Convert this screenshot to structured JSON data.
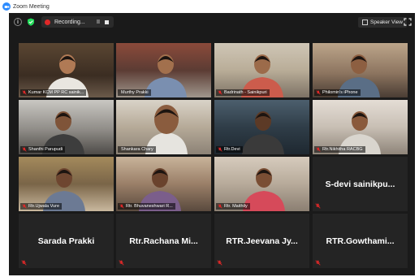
{
  "titlebar": {
    "title": "Zoom Meeting"
  },
  "topbar": {
    "recording_label": "Recording...",
    "pause_glyph": "II",
    "view_label": "Speaker View"
  },
  "colors": {
    "active_speaker_border": "#c9e53f",
    "recording": "#e02828",
    "mic_muted": "#e02828"
  },
  "participants": [
    {
      "name": "Kumar KCM PP RC sainik...",
      "video": true,
      "muted": true
    },
    {
      "name": "Murthy Prakki",
      "video": true,
      "muted": false
    },
    {
      "name": "Badrinath - Sainikpuri",
      "video": true,
      "muted": true
    },
    {
      "name": "Philomin's iPhone",
      "video": true,
      "muted": true
    },
    {
      "name": "Shanthi Parupudi",
      "video": true,
      "muted": true
    },
    {
      "name": "Shankara Chary",
      "video": true,
      "muted": false,
      "active": true
    },
    {
      "name": "Rtr.Devi",
      "video": true,
      "muted": true
    },
    {
      "name": "Rtr.Nikhitha RACBG",
      "video": true,
      "muted": true
    },
    {
      "name": "Rtr.Ujwala Vure",
      "video": true,
      "muted": true
    },
    {
      "name": "Rtr. Bhuvaneshwari R...",
      "video": true,
      "muted": true
    },
    {
      "name": "Rtr. Maithily",
      "video": true,
      "muted": true
    },
    {
      "name": "S-devi  sainikpu...",
      "video": false,
      "muted": true
    },
    {
      "name": "Sarada Prakki",
      "video": false,
      "muted": true
    },
    {
      "name": "Rtr.Rachana  Mi...",
      "video": false,
      "muted": true
    },
    {
      "name": "RTR.Jeevana  Jy...",
      "video": false,
      "muted": true
    },
    {
      "name": "RTR.Gowthami...",
      "video": false,
      "muted": true
    }
  ]
}
